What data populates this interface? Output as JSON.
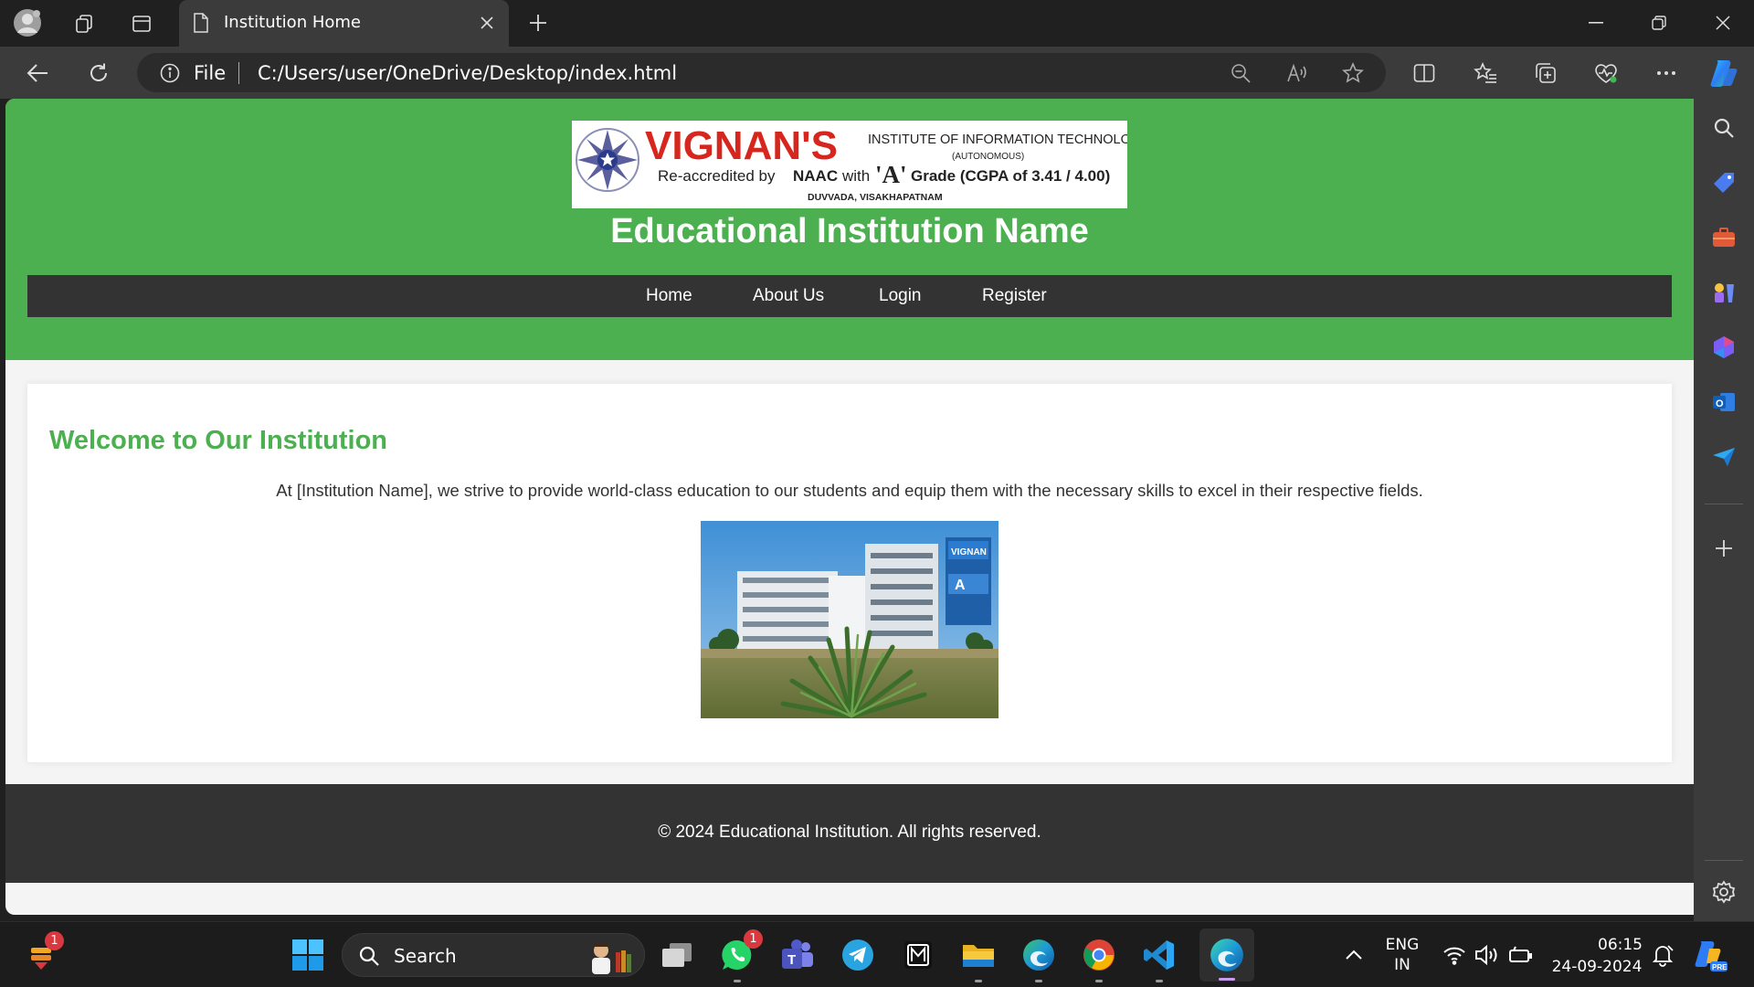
{
  "browser": {
    "tab_title": "Institution Home",
    "address_scheme": "File",
    "url": "C:/Users/user/OneDrive/Desktop/index.html"
  },
  "logo": {
    "brand": "VIGNAN'S",
    "institute": "INSTITUTE OF INFORMATION TECHNOLOGY",
    "autonomous": "(AUTONOMOUS)",
    "accreditation_prefix": "Re-accredited by",
    "accreditation_body": "NAAC",
    "accreditation_with": "with",
    "grade_letter": "'A'",
    "grade_text": "Grade (CGPA of 3.41 / 4.00)",
    "location": "DUVVADA, VISAKHAPATNAM"
  },
  "site": {
    "title": "Educational Institution Name",
    "nav": [
      "Home",
      "About Us",
      "Login",
      "Register"
    ],
    "welcome_heading": "Welcome to Our Institution",
    "intro": "At [Institution Name], we strive to provide world-class education to our students and equip them with the necessary skills to excel in their respective fields.",
    "photo_sign_brand": "VIGNAN",
    "photo_sign_grade": "A",
    "footer": "© 2024 Educational Institution. All rights reserved."
  },
  "taskbar": {
    "search_label": "Search",
    "widget_badge": "1",
    "whatsapp_badge": "1",
    "language_line1": "ENG",
    "language_line2": "IN",
    "time": "06:15",
    "date": "24-09-2024"
  },
  "colors": {
    "brand_green": "#4caf50",
    "nav_dark": "#333333",
    "logo_red": "#d7261e",
    "browser_chrome": "#3b3b3b"
  },
  "icons": {
    "tabbar": [
      "profile-avatar-icon",
      "workspaces-icon",
      "vertical-tabs-icon",
      "page-icon",
      "close-icon",
      "new-tab-icon",
      "minimize-icon",
      "restore-icon",
      "close-window-icon"
    ],
    "toolbar": [
      "back-icon",
      "refresh-icon",
      "info-icon",
      "zoom-out-icon",
      "read-aloud-icon",
      "favorite-star-icon",
      "split-screen-icon",
      "favorites-icon",
      "collections-icon",
      "browser-essentials-icon",
      "more-icon",
      "copilot-icon"
    ],
    "sidebar": [
      "search-icon",
      "shopping-tag-icon",
      "tools-icon",
      "games-icon",
      "microsoft-365-icon",
      "outlook-icon",
      "send-icon",
      "add-icon",
      "settings-icon"
    ],
    "taskbar": [
      "weather-widget-icon",
      "start-icon",
      "task-view-icon",
      "whatsapp-icon",
      "teams-icon",
      "telegram-icon",
      "notebook-icon",
      "file-explorer-icon",
      "edge-icon",
      "chrome-icon",
      "vscode-icon",
      "edge-dev-icon",
      "tray-chevron-icon",
      "wifi-icon",
      "volume-icon",
      "battery-icon",
      "notification-icon",
      "copilot-pre-icon"
    ]
  }
}
